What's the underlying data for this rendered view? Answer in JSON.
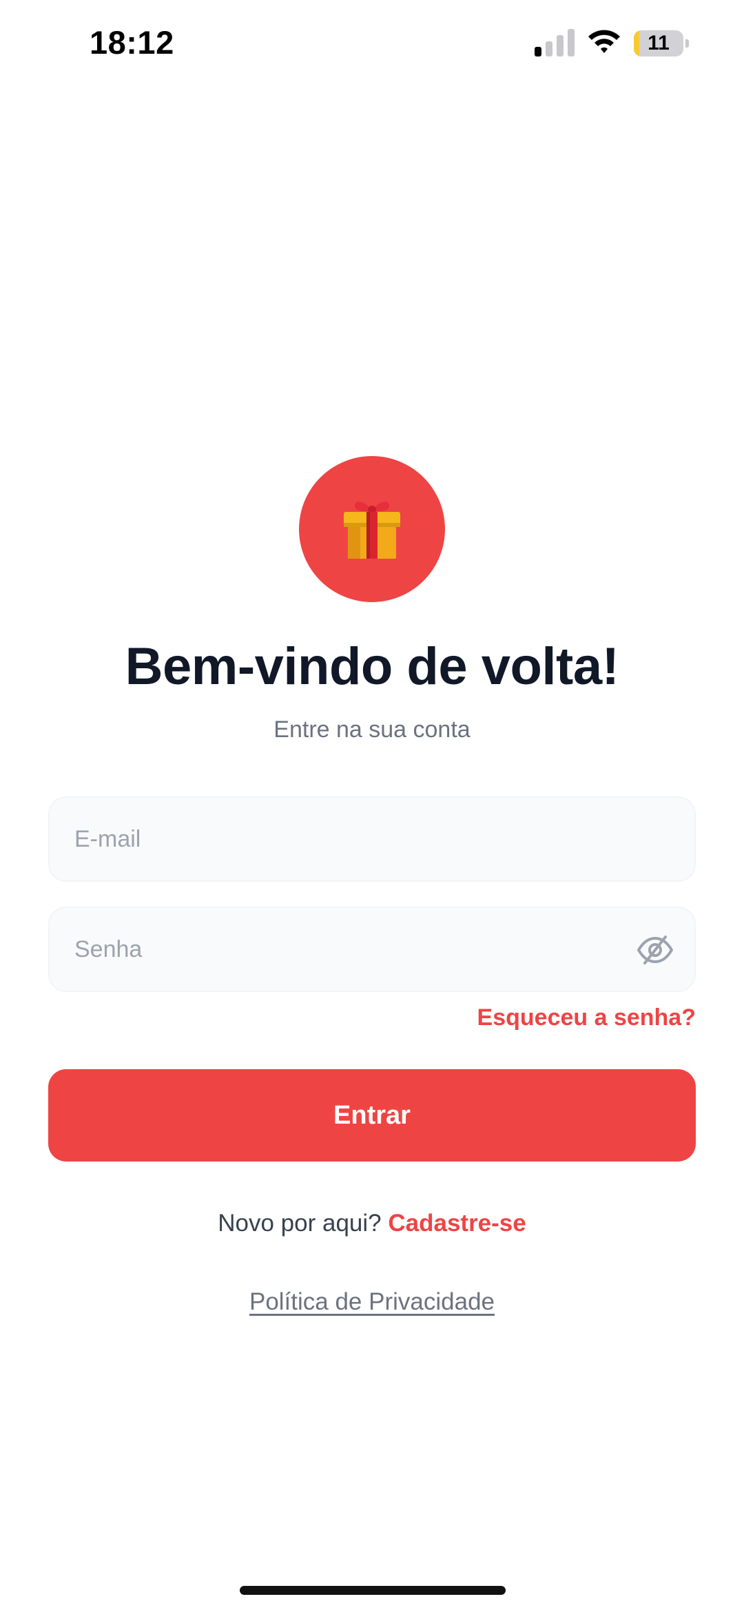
{
  "status_bar": {
    "time": "18:12",
    "battery_level": "11",
    "battery_fraction": 0.11,
    "signal_bars_active": 1,
    "signal_bars_total": 4,
    "icons": [
      "cellular-signal-icon",
      "wifi-icon",
      "battery-icon"
    ]
  },
  "logo": {
    "icon": "gift-icon",
    "background_color": "#EF4444"
  },
  "header": {
    "title": "Bem-vindo de volta!",
    "subtitle": "Entre na sua conta"
  },
  "form": {
    "email": {
      "value": "",
      "placeholder": "E-mail"
    },
    "password": {
      "value": "",
      "placeholder": "Senha",
      "toggle_icon": "eye-slash-icon"
    },
    "forgot_label": "Esqueceu a senha?",
    "submit_label": "Entrar"
  },
  "footer": {
    "signup_prompt": "Novo por aqui?",
    "signup_link": "Cadastre-se",
    "privacy_link": "Política de Privacidade"
  },
  "colors": {
    "accent": "#EF4444",
    "title": "#111827",
    "muted": "#6B7280",
    "field_background": "#F9FAFB"
  }
}
